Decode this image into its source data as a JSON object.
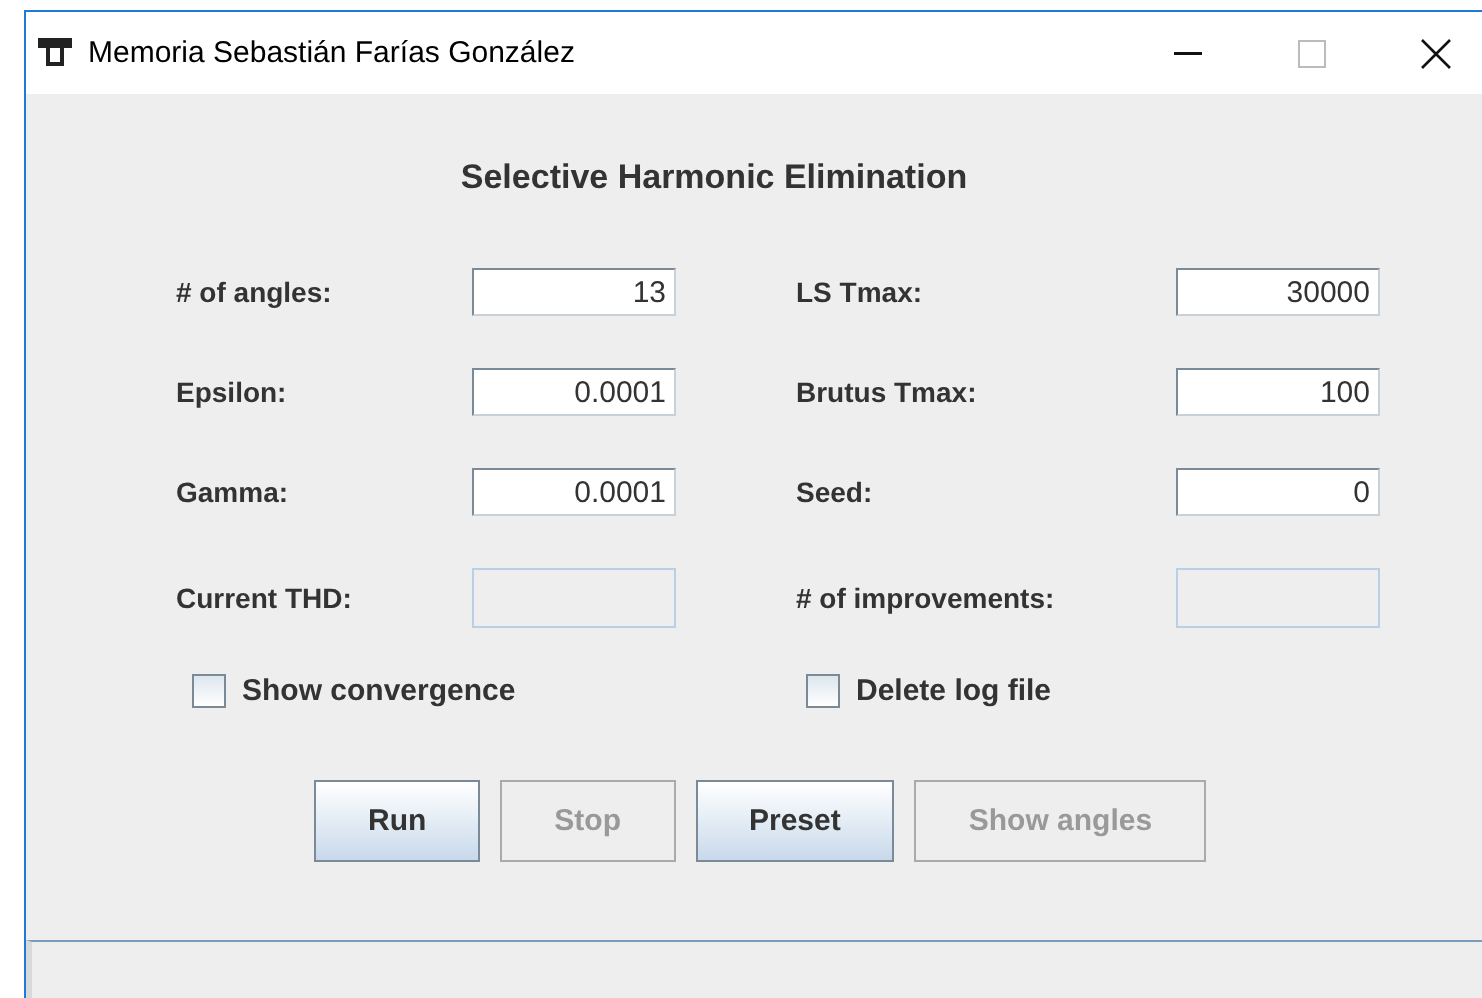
{
  "window": {
    "title": "Memoria Sebastián Farías González"
  },
  "heading": "Selective Harmonic Elimination",
  "fields": [
    {
      "label": "# of angles:",
      "value": "13",
      "disabled": false
    },
    {
      "label": "LS Tmax:",
      "value": "30000",
      "disabled": false
    },
    {
      "label": "Epsilon:",
      "value": "0.0001",
      "disabled": false
    },
    {
      "label": "Brutus Tmax:",
      "value": "100",
      "disabled": false
    },
    {
      "label": "Gamma:",
      "value": "0.0001",
      "disabled": false
    },
    {
      "label": "Seed:",
      "value": "0",
      "disabled": false
    },
    {
      "label": "Current THD:",
      "disabled": true
    },
    {
      "label": "# of improvements:",
      "disabled": true
    }
  ],
  "checkboxes": [
    {
      "label": "Show convergence",
      "checked": false
    },
    {
      "label": "Delete log file",
      "checked": false
    }
  ],
  "buttons": [
    {
      "label": "Run",
      "disabled": false
    },
    {
      "label": "Stop",
      "disabled": true
    },
    {
      "label": "Preset",
      "disabled": false
    },
    {
      "label": "Show angles",
      "disabled": true
    }
  ]
}
